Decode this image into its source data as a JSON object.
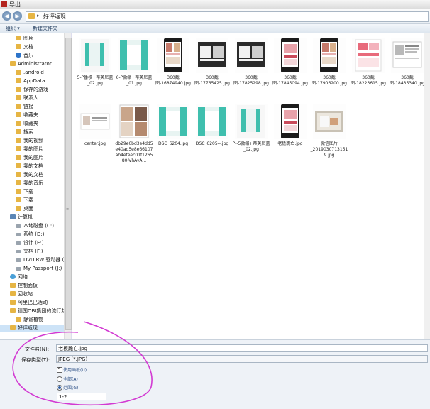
{
  "window": {
    "title": "导出"
  },
  "address": {
    "path": "好评返现"
  },
  "toolbar": {
    "organize": "组织 ▾",
    "new_folder": "新建文件夹"
  },
  "nav": [
    {
      "label": "图片",
      "icon": "folder",
      "indent": 22
    },
    {
      "label": "文档",
      "icon": "folder",
      "indent": 22
    },
    {
      "label": "音乐",
      "icon": "note",
      "indent": 22
    },
    {
      "label": "Administrator",
      "icon": "folder",
      "indent": 14
    },
    {
      "label": ".android",
      "icon": "folder",
      "indent": 22
    },
    {
      "label": "AppData",
      "icon": "folder",
      "indent": 22
    },
    {
      "label": "保存的游戏",
      "icon": "folder",
      "indent": 22
    },
    {
      "label": "联系人",
      "icon": "folder",
      "indent": 22
    },
    {
      "label": "链接",
      "icon": "folder",
      "indent": 22
    },
    {
      "label": "收藏夹",
      "icon": "folder",
      "indent": 22
    },
    {
      "label": "收藏夹",
      "icon": "folder",
      "indent": 22
    },
    {
      "label": "搜索",
      "icon": "folder",
      "indent": 22
    },
    {
      "label": "我的视频",
      "icon": "folder",
      "indent": 22
    },
    {
      "label": "我的图片",
      "icon": "folder",
      "indent": 22
    },
    {
      "label": "我的图片",
      "icon": "folder",
      "indent": 22
    },
    {
      "label": "我的文档",
      "icon": "folder",
      "indent": 22
    },
    {
      "label": "我的文档",
      "icon": "folder",
      "indent": 22
    },
    {
      "label": "我的音乐",
      "icon": "folder",
      "indent": 22
    },
    {
      "label": "下载",
      "icon": "folder",
      "indent": 22
    },
    {
      "label": "下载",
      "icon": "folder",
      "indent": 22
    },
    {
      "label": "桌面",
      "icon": "folder",
      "indent": 22
    },
    {
      "label": "计算机",
      "icon": "computer",
      "indent": 14
    },
    {
      "label": "本地磁盘 (C:)",
      "icon": "drive",
      "indent": 22
    },
    {
      "label": "系统 (D:)",
      "icon": "drive",
      "indent": 22
    },
    {
      "label": "设计 (E:)",
      "icon": "drive",
      "indent": 22
    },
    {
      "label": "文档 (F:)",
      "icon": "drive",
      "indent": 22
    },
    {
      "label": "DVD RW 驱动器 (G:",
      "icon": "drive",
      "indent": 22
    },
    {
      "label": "My Passport (J:)",
      "icon": "drive",
      "indent": 22
    },
    {
      "label": "网络",
      "icon": "net",
      "indent": 14
    },
    {
      "label": "控制面板",
      "icon": "folder",
      "indent": 14
    },
    {
      "label": "回收站",
      "icon": "folder",
      "indent": 14
    },
    {
      "label": "阿里巴巴活动",
      "icon": "folder",
      "indent": 14
    },
    {
      "label": "德国OBI集团的流行趋",
      "icon": "folder",
      "indent": 14
    },
    {
      "label": "静谧植物",
      "icon": "folder",
      "indent": 22
    },
    {
      "label": "好评返现",
      "icon": "folder",
      "indent": 14,
      "selected": true
    }
  ],
  "files": [
    {
      "name": "5-P番模+蒂芙尼蓝_02.jpg",
      "kind": "curtain"
    },
    {
      "name": "6-P微缩+蒂芙尼蓝_01.jpg",
      "kind": "curtain2"
    },
    {
      "name": "360截图-16874940.jpg",
      "kind": "phone"
    },
    {
      "name": "360截图-17765425.jpg",
      "kind": "shop"
    },
    {
      "name": "360截图-17825298.jpg",
      "kind": "shop"
    },
    {
      "name": "360截图-17845094.jpg",
      "kind": "phonepink"
    },
    {
      "name": "360截图-17906200.jpg",
      "kind": "phone"
    },
    {
      "name": "360截图-18223615.jpg",
      "kind": "pink"
    },
    {
      "name": "360截图-18435340.jpg",
      "kind": "doc"
    },
    {
      "name": "center.jpg",
      "kind": "center"
    },
    {
      "name": "db29e6bd3e4dd5e40ad5e8e66107ab4efeec01f126580-VhAyA...",
      "kind": "collage"
    },
    {
      "name": "DSC_6204.jpg",
      "kind": "curtain2"
    },
    {
      "name": "DSC_6205--.jpg",
      "kind": "curtain2"
    },
    {
      "name": "P--5微缩+蒂芙尼蓝_02.jpg",
      "kind": "curtain"
    },
    {
      "name": "老板跪亡.jpg",
      "kind": "phonepink"
    },
    {
      "name": "微信图片_20190307131519.jpg",
      "kind": "photo"
    }
  ],
  "form": {
    "filename_label": "文件名(N):",
    "filename_value": "老板跪亡.jpg",
    "type_label": "保存类型(T):",
    "type_value": "JPEG (*.JPG)",
    "use_artboards_label": "使用画板(U)",
    "all_label": "全部(A)",
    "range_label": "范围(G):",
    "range_value": "1-2"
  },
  "colors": {
    "annotation": "#d23ad2",
    "curtain": "#3fbfae"
  }
}
